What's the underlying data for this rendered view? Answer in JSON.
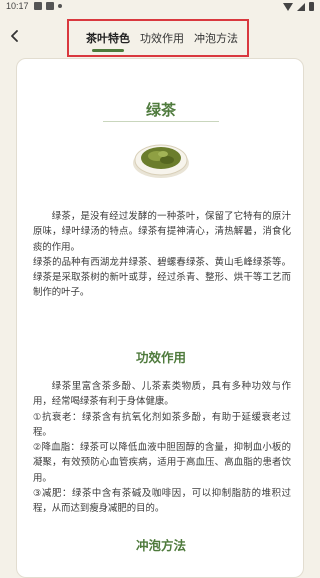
{
  "status": {
    "time": "10:17"
  },
  "tabs": [
    {
      "label": "茶叶特色",
      "active": true
    },
    {
      "label": "功效作用",
      "active": false
    },
    {
      "label": "冲泡方法",
      "active": false
    }
  ],
  "content": {
    "title": "绿茶",
    "intro": [
      "绿茶，是没有经过发酵的一种茶叶，保留了它特有的原汁原味，绿叶绿汤的特点。绿茶有提神清心，清热解暑，消食化痰的作用。",
      "绿茶的品种有西湖龙井绿茶、碧螺春绿茶、黄山毛峰绿茶等。绿茶是采取茶树的新叶或芽，经过杀青、整形、烘干等工艺而制作的叶子。"
    ],
    "effects_title": "功效作用",
    "effects": [
      "绿茶里富含茶多酚、儿茶素类物质，具有多种功效与作用，经常喝绿茶有利于身体健康。",
      "①抗衰老：绿茶含有抗氧化剂如茶多酚，有助于延缓衰老过程。",
      "②降血脂：绿茶可以降低血液中胆固醇的含量，抑制血小板的凝聚，有效预防心血管疾病，适用于高血压、高血脂的患者饮用。",
      "③减肥：绿茶中含有茶碱及咖啡因，可以抑制脂肪的堆积过程，从而达到瘦身减肥的目的。"
    ],
    "brew_title": "冲泡方法"
  },
  "colors": {
    "accent": "#4e7a3c",
    "highlight_box": "#d9383e",
    "background": "#f4f1e8"
  }
}
